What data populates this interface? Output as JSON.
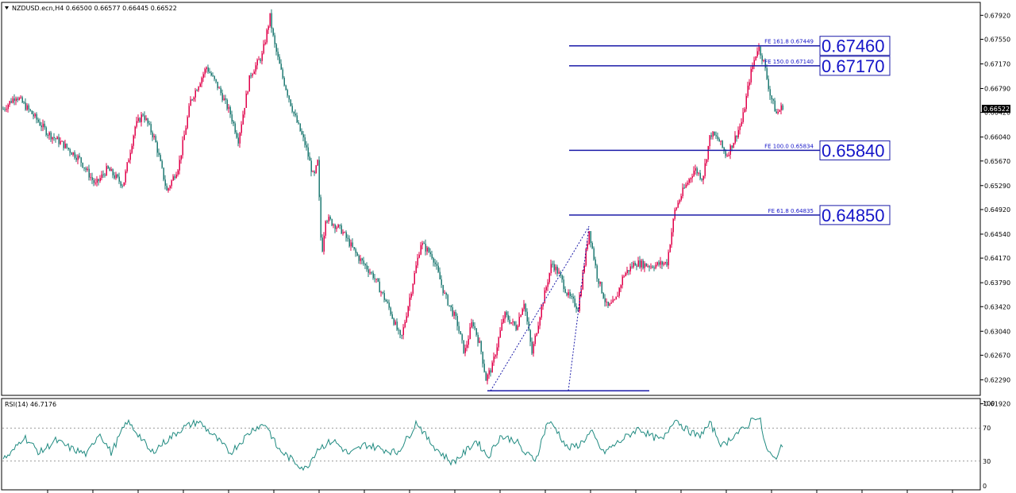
{
  "window": {
    "header": "NZDUSD.ecn,H4  0.66500 0.66577 0.66445 0.66522",
    "menu_icon": "triangle-down-icon"
  },
  "chart_data": [
    {
      "type": "candlestick",
      "symbol": "NZDUSD.ecn",
      "timeframe": "H4",
      "ohlc_header": {
        "open": 0.665,
        "high": 0.66577,
        "low": 0.66445,
        "close": 0.66522
      },
      "ylim": [
        0.6205,
        0.6812
      ],
      "y_ticks": [
        "0.67920",
        "0.67550",
        "0.67170",
        "0.66790",
        "0.66420",
        "0.66040",
        "0.65670",
        "0.65290",
        "0.64920",
        "0.64540",
        "0.64170",
        "0.63790",
        "0.63420",
        "0.63040",
        "0.62670",
        "0.62290",
        "0.61920"
      ],
      "last_price": "0.66522",
      "colors": {
        "bull": "#e0004a",
        "bear": "#1f7a73",
        "line": "#1a1aa8"
      },
      "price_path": [
        [
          0,
          0.6642
        ],
        [
          20,
          0.6668
        ],
        [
          40,
          0.664
        ],
        [
          60,
          0.661
        ],
        [
          80,
          0.6592
        ],
        [
          100,
          0.657
        ],
        [
          120,
          0.653
        ],
        [
          135,
          0.6555
        ],
        [
          155,
          0.653
        ],
        [
          170,
          0.662
        ],
        [
          180,
          0.664
        ],
        [
          195,
          0.66
        ],
        [
          210,
          0.652
        ],
        [
          225,
          0.656
        ],
        [
          240,
          0.666
        ],
        [
          260,
          0.6712
        ],
        [
          275,
          0.668
        ],
        [
          290,
          0.664
        ],
        [
          300,
          0.66
        ],
        [
          315,
          0.67
        ],
        [
          330,
          0.673
        ],
        [
          340,
          0.679
        ],
        [
          345,
          0.675
        ],
        [
          355,
          0.67
        ],
        [
          370,
          0.664
        ],
        [
          385,
          0.659
        ],
        [
          395,
          0.654
        ],
        [
          400,
          0.6565
        ],
        [
          405,
          0.642
        ],
        [
          410,
          0.648
        ],
        [
          430,
          0.646
        ],
        [
          450,
          0.642
        ],
        [
          470,
          0.639
        ],
        [
          490,
          0.634
        ],
        [
          505,
          0.629
        ],
        [
          515,
          0.635
        ],
        [
          530,
          0.644
        ],
        [
          545,
          0.642
        ],
        [
          560,
          0.636
        ],
        [
          575,
          0.632
        ],
        [
          585,
          0.627
        ],
        [
          595,
          0.632
        ],
        [
          605,
          0.628
        ],
        [
          612,
          0.623
        ],
        [
          620,
          0.625
        ],
        [
          635,
          0.633
        ],
        [
          650,
          0.631
        ],
        [
          660,
          0.635
        ],
        [
          670,
          0.627
        ],
        [
          680,
          0.633
        ],
        [
          695,
          0.641
        ],
        [
          705,
          0.639
        ],
        [
          715,
          0.636
        ],
        [
          728,
          0.634
        ],
        [
          742,
          0.646
        ],
        [
          752,
          0.639
        ],
        [
          765,
          0.634
        ],
        [
          775,
          0.635
        ],
        [
          785,
          0.639
        ],
        [
          800,
          0.641
        ],
        [
          820,
          0.6405
        ],
        [
          840,
          0.641
        ],
        [
          850,
          0.649
        ],
        [
          860,
          0.652
        ],
        [
          875,
          0.6555
        ],
        [
          885,
          0.654
        ],
        [
          895,
          0.661
        ],
        [
          905,
          0.66
        ],
        [
          915,
          0.6575
        ],
        [
          925,
          0.66
        ],
        [
          935,
          0.663
        ],
        [
          945,
          0.67
        ],
        [
          955,
          0.6745
        ],
        [
          962,
          0.672
        ],
        [
          970,
          0.667
        ],
        [
          978,
          0.664
        ],
        [
          986,
          0.6652
        ]
      ],
      "fibonacci_lines": [
        {
          "label": "FE 161.8  0.67449",
          "value": 0.67449,
          "price_box": "0.67460"
        },
        {
          "label": "FE 150.0  0.67140",
          "value": 0.6714,
          "price_box": "0.67170"
        },
        {
          "label": "FE 100.0  0.65834",
          "value": 0.65834,
          "price_box": "0.65840"
        },
        {
          "label": "FE 61.8  0.64835",
          "value": 0.64835,
          "price_box": "0.64850"
        }
      ],
      "base_line_value": 0.6212,
      "projection": [
        [
          618,
          0.6212
        ],
        [
          742,
          0.6466
        ],
        [
          716,
          0.6212
        ]
      ]
    },
    {
      "type": "line",
      "indicator": "RSI(14)",
      "header": "RSI(14) 46.7176",
      "value": 46.7176,
      "ylim": [
        0,
        100
      ],
      "y_ticks": [
        "100",
        "70",
        "30",
        "0"
      ],
      "levels": [
        70,
        30
      ],
      "path": [
        [
          0,
          30
        ],
        [
          15,
          40
        ],
        [
          30,
          60
        ],
        [
          50,
          40
        ],
        [
          70,
          55
        ],
        [
          90,
          45
        ],
        [
          110,
          38
        ],
        [
          125,
          65
        ],
        [
          140,
          40
        ],
        [
          160,
          78
        ],
        [
          175,
          62
        ],
        [
          190,
          40
        ],
        [
          210,
          55
        ],
        [
          230,
          70
        ],
        [
          250,
          78
        ],
        [
          270,
          60
        ],
        [
          290,
          40
        ],
        [
          305,
          55
        ],
        [
          320,
          70
        ],
        [
          335,
          75
        ],
        [
          350,
          45
        ],
        [
          370,
          30
        ],
        [
          385,
          20
        ],
        [
          400,
          45
        ],
        [
          420,
          55
        ],
        [
          440,
          38
        ],
        [
          460,
          50
        ],
        [
          480,
          45
        ],
        [
          500,
          40
        ],
        [
          515,
          60
        ],
        [
          525,
          78
        ],
        [
          540,
          55
        ],
        [
          555,
          40
        ],
        [
          570,
          28
        ],
        [
          585,
          40
        ],
        [
          600,
          55
        ],
        [
          615,
          35
        ],
        [
          630,
          60
        ],
        [
          650,
          55
        ],
        [
          660,
          40
        ],
        [
          675,
          32
        ],
        [
          690,
          78
        ],
        [
          700,
          70
        ],
        [
          715,
          45
        ],
        [
          730,
          50
        ],
        [
          745,
          65
        ],
        [
          760,
          40
        ],
        [
          775,
          50
        ],
        [
          790,
          60
        ],
        [
          805,
          70
        ],
        [
          820,
          60
        ],
        [
          835,
          55
        ],
        [
          850,
          82
        ],
        [
          865,
          68
        ],
        [
          880,
          60
        ],
        [
          895,
          75
        ],
        [
          910,
          48
        ],
        [
          925,
          62
        ],
        [
          940,
          70
        ],
        [
          950,
          85
        ],
        [
          958,
          78
        ],
        [
          965,
          45
        ],
        [
          975,
          32
        ],
        [
          985,
          46.7
        ]
      ]
    }
  ]
}
